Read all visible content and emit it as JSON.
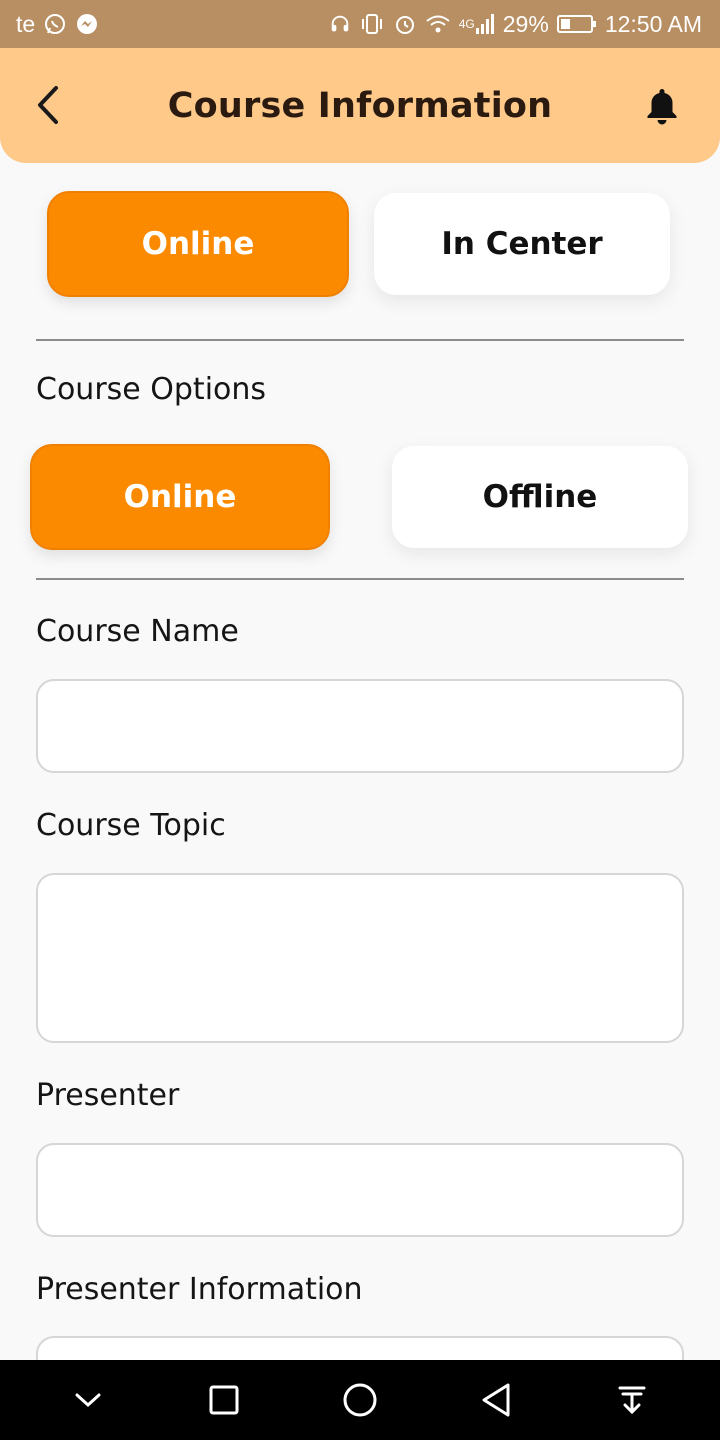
{
  "status_bar": {
    "carrier": "te",
    "battery": "29%",
    "time": "12:50 AM",
    "network": "4G",
    "icons": [
      "whatsapp-icon",
      "messenger-icon",
      "headphones-icon",
      "vibrate-icon",
      "alarm-icon",
      "wifi-icon",
      "signal-icon",
      "battery-icon"
    ]
  },
  "header": {
    "title": "Course Information",
    "back_icon": "chevron-left-icon",
    "notification_icon": "bell-icon",
    "background": "#ffc98a"
  },
  "location_toggle": {
    "options": [
      "Online",
      "In Center"
    ],
    "selected": "Online"
  },
  "course_options": {
    "label": "Course Options",
    "options": [
      "Online",
      "Offline"
    ],
    "selected": "Online"
  },
  "form": {
    "course_name": {
      "label": "Course Name",
      "value": ""
    },
    "course_topic": {
      "label": "Course Topic",
      "value": ""
    },
    "presenter": {
      "label": "Presenter",
      "value": ""
    },
    "presenter_information": {
      "label": "Presenter Information",
      "value": ""
    }
  },
  "colors": {
    "accent": "#fb8a00",
    "status_bar": "#b88f63",
    "background": "#f9f9f9"
  },
  "nav_bar": {
    "icons": [
      "chevron-down-icon",
      "square-icon",
      "circle-icon",
      "triangle-back-icon",
      "download-icon"
    ]
  }
}
